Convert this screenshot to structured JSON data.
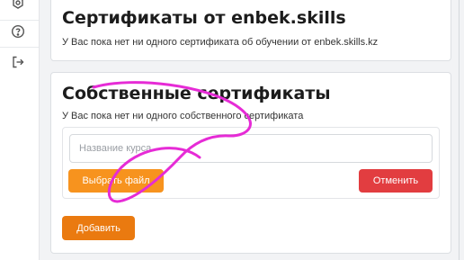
{
  "sidebar": {
    "icons": [
      "badge-icon",
      "help-circle-icon",
      "logout-icon"
    ]
  },
  "enbek_section": {
    "title": "Сертификаты от enbek.skills",
    "subtitle": "У Вас пока нет ни одного сертификата об обучении от enbek.skills.kz"
  },
  "own_section": {
    "title": "Собственные сертификаты",
    "subtitle": "У Вас пока нет ни одного собственного сертификата",
    "course_input": {
      "placeholder": "Название курса",
      "value": ""
    },
    "choose_file_label": "Выбрать файл",
    "cancel_label": "Отменить",
    "add_label": "Добавить"
  },
  "colors": {
    "choose_file": "#f7931e",
    "cancel": "#e23d40",
    "add": "#ea7a10",
    "annotation": "#e62bd6"
  }
}
